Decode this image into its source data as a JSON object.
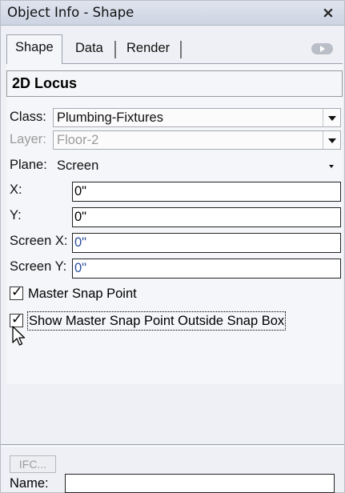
{
  "window": {
    "title": "Object Info - Shape",
    "close_glyph": "×"
  },
  "tabs": [
    {
      "label": "Shape",
      "active": true
    },
    {
      "label": "Data",
      "active": false
    },
    {
      "label": "Render",
      "active": false
    }
  ],
  "object_type": "2D Locus",
  "fields": {
    "class": {
      "label": "Class:",
      "value": "Plumbing-Fixtures"
    },
    "layer": {
      "label": "Layer:",
      "value": "Floor-2",
      "disabled": true
    },
    "plane": {
      "label": "Plane:",
      "value": "Screen"
    },
    "x": {
      "label": "X:",
      "value": "0\""
    },
    "y": {
      "label": "Y:",
      "value": "0\""
    },
    "screen_x": {
      "label": "Screen X:",
      "value": "0\""
    },
    "screen_y": {
      "label": "Screen Y:",
      "value": "0\""
    }
  },
  "checkboxes": {
    "master_snap_point": {
      "label": "Master Snap Point",
      "checked": true
    },
    "show_outside_snap_box": {
      "label": "Show Master Snap Point Outside Snap Box",
      "checked": true
    }
  },
  "footer": {
    "ifc_button": "IFC...",
    "name_label": "Name:",
    "name_value": ""
  },
  "icons": {
    "close": "close-icon",
    "scroll": "scroll-right-icon",
    "cursor": "mouse-pointer-icon"
  }
}
